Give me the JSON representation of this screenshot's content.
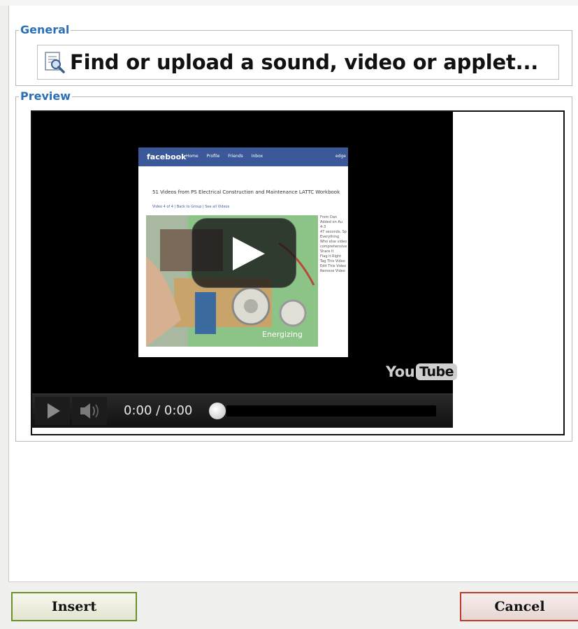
{
  "general": {
    "legend": "General",
    "url_text": "Find or upload a sound, video or applet..."
  },
  "preview": {
    "legend": "Preview",
    "thumbnail": {
      "site": "facebook",
      "nav": [
        "Home",
        "Profile",
        "Friends",
        "Inbox"
      ],
      "nav_right": "edge",
      "title": "51 Videos from PS Electrical Construction and Maintenance LATTC Workbook",
      "subtitle": "Video 4 of 4 | Back to Group | See all Videos",
      "side_text": [
        "From Dan",
        "Added on Au",
        "4-3",
        "47 seconds, Sp",
        "Everything",
        "Who else video",
        "comprehensive",
        "Share It",
        "Flag it Right",
        "Tag This Video",
        "Edit This Video",
        "Remove Video"
      ],
      "caption": "Energizing"
    },
    "player": {
      "time": "0:00 / 0:00",
      "progress": 0.0,
      "logo_you": "You",
      "logo_tube": "Tube"
    }
  },
  "footer": {
    "insert_label": "Insert",
    "cancel_label": "Cancel"
  },
  "colors": {
    "legend": "#2b6fb6",
    "insert_border": "#6d8f2a",
    "cancel_border": "#c0392b",
    "facebook_blue": "#3b5998"
  }
}
